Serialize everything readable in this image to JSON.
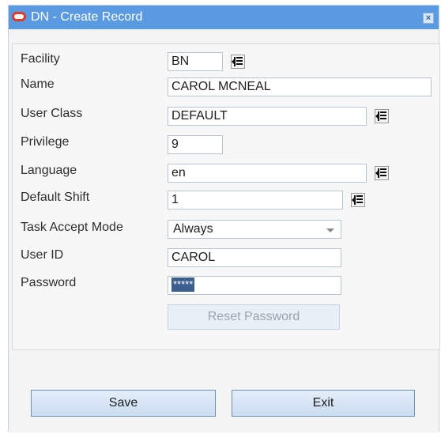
{
  "window": {
    "title": "DN - Create Record",
    "close_glyph": "×"
  },
  "form": {
    "facility": {
      "label": "Facility",
      "value": "BN"
    },
    "name": {
      "label": "Name",
      "value": "CAROL MCNEAL"
    },
    "user_class": {
      "label": "User Class",
      "value": "DEFAULT"
    },
    "privilege": {
      "label": "Privilege",
      "value": "9"
    },
    "language": {
      "label": "Language",
      "value": "en"
    },
    "default_shift": {
      "label": "Default Shift",
      "value": "1"
    },
    "task_accept_mode": {
      "label": "Task Accept Mode",
      "value": "Always"
    },
    "user_id": {
      "label": "User ID",
      "value": "CAROL"
    },
    "password": {
      "label": "Password",
      "value": "*****"
    },
    "reset_password_label": "Reset Password"
  },
  "footer": {
    "save_label": "Save",
    "exit_label": "Exit"
  },
  "icons": {
    "lov": "list-of-values-icon",
    "close": "close-icon",
    "logo": "oracle-logo-icon",
    "dropdown": "chevron-down-icon"
  },
  "colors": {
    "titlebar": "#5a9ae0",
    "logo_red": "#e23a2a",
    "button_border": "#6d8fb3"
  }
}
